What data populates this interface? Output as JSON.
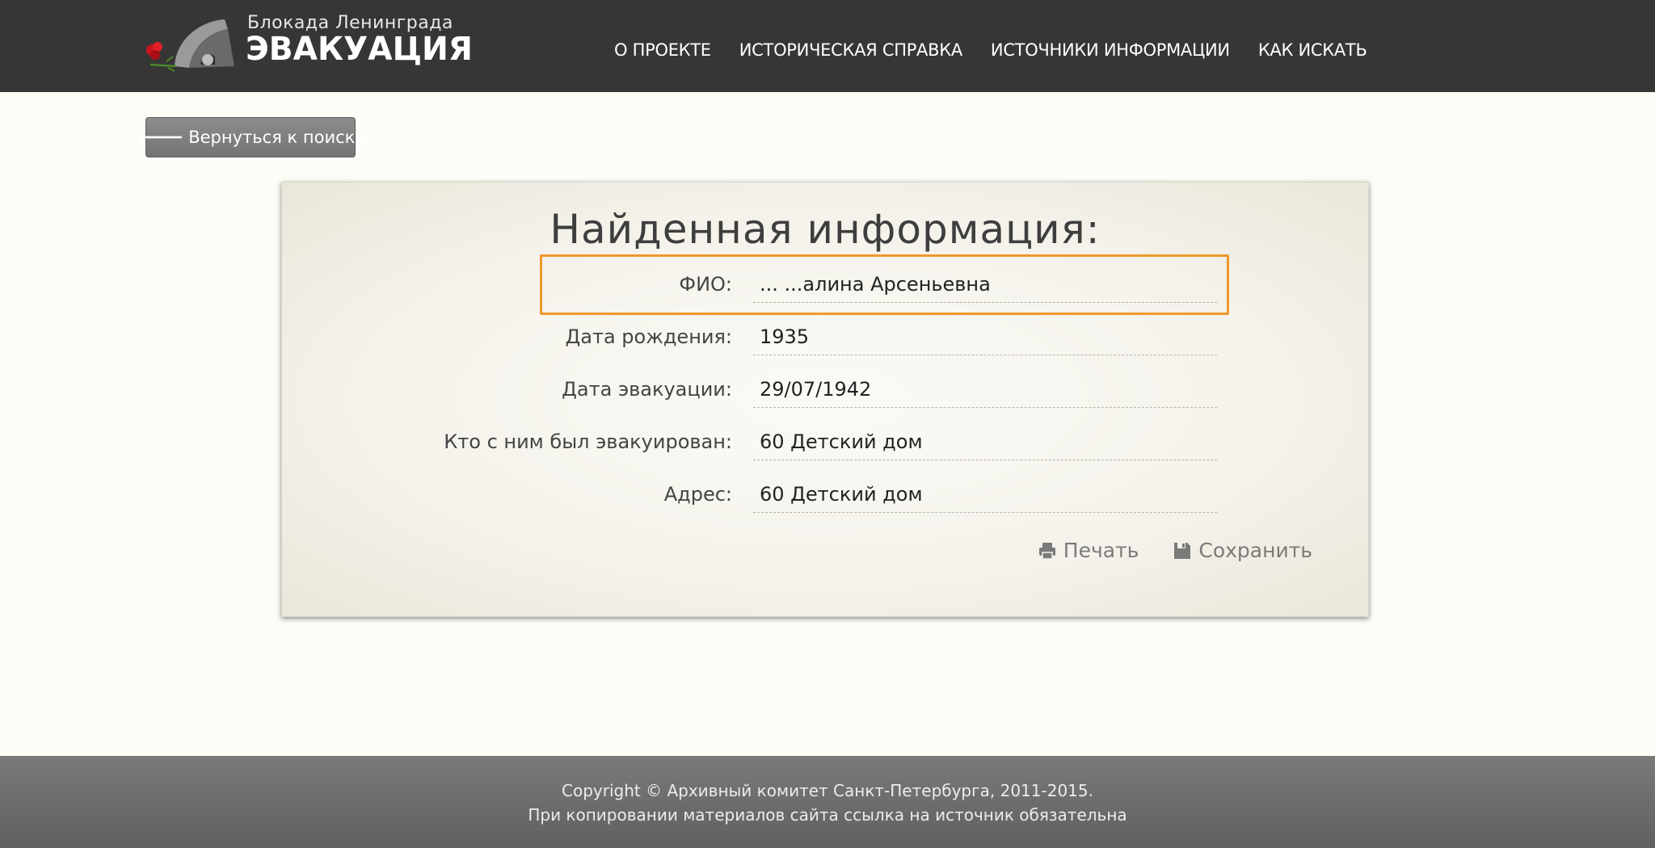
{
  "header": {
    "logo_subtitle": "Блокада Ленинграда",
    "logo_title": "ЭВАКУАЦИЯ",
    "nav": [
      {
        "label": "О ПРОЕКТЕ"
      },
      {
        "label": "ИСТОРИЧЕСКАЯ СПРАВКА"
      },
      {
        "label": "ИСТОЧНИКИ ИНФОРМАЦИИ"
      },
      {
        "label": "КАК ИСКАТЬ"
      }
    ]
  },
  "back_button": {
    "label": "Вернуться к поиску",
    "icon": "arrow-left-icon"
  },
  "card": {
    "title": "Найденная информация:",
    "fields": [
      {
        "label": "ФИО:",
        "value": "... ...алина Арсеньевна"
      },
      {
        "label": "Дата рождения:",
        "value": "1935"
      },
      {
        "label": "Дата эвакуации:",
        "value": "29/07/1942"
      },
      {
        "label": "Кто с ним был эвакуирован:",
        "value": "60 Детский дом"
      },
      {
        "label": "Адрес:",
        "value": "60 Детский дом"
      }
    ],
    "highlight_color": "#f0982c",
    "actions": {
      "print": {
        "label": "Печать",
        "icon": "printer-icon"
      },
      "save": {
        "label": "Сохранить",
        "icon": "floppy-disk-icon"
      }
    }
  },
  "footer": {
    "line1": "Copyright © Архивный комитет Санкт-Петербурга, 2011-2015.",
    "line2": "При копировании материалов сайта ссылка на источник обязательна"
  },
  "colors": {
    "header_bg": "#363636",
    "page_bg": "#fdfdf8",
    "footer_bg": "#6e6e6e",
    "accent": "#f0982c"
  }
}
